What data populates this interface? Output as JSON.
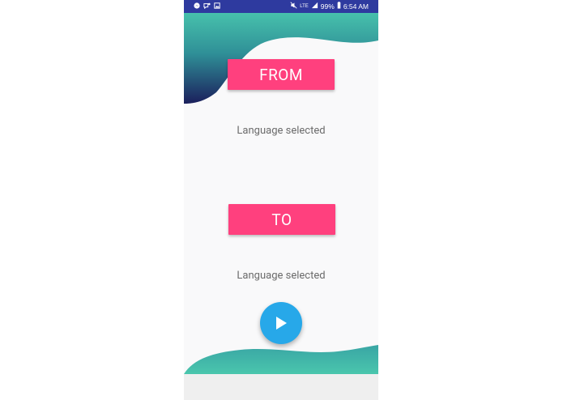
{
  "status_bar": {
    "left_icons": [
      "messenger-icon",
      "notification-icon",
      "image-icon"
    ],
    "signal_text": "LTE",
    "battery": "99%",
    "time": "6:54 AM"
  },
  "from_section": {
    "button_label": "FROM",
    "selected_label": "Language selected"
  },
  "to_section": {
    "button_label": "TO",
    "selected_label": "Language selected"
  },
  "play_button": {
    "icon": "play-icon"
  },
  "colors": {
    "status_bar": "#2e3a9f",
    "accent_button": "#ff407e",
    "fab": "#27a8e9",
    "wave_teal": "#47c1ac",
    "wave_navy": "#1b1f5c"
  }
}
